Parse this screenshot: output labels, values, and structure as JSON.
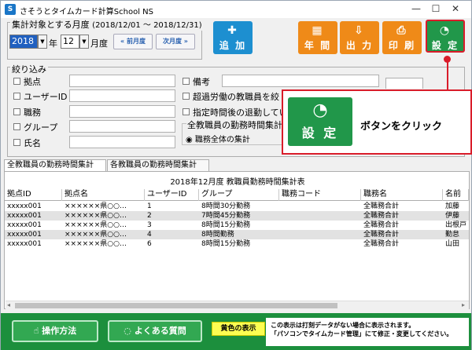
{
  "window": {
    "title": "さそうとタイムカード計算School NS",
    "app_icon": "S",
    "minimize": "—",
    "maximize": "☐",
    "close": "✕"
  },
  "period": {
    "legend": "集計対象とする月度",
    "range": "(2018/12/01 〜 2018/12/31)",
    "year": "2018",
    "year_suffix": "年",
    "month": "12",
    "month_suffix": "月度",
    "prev_label": "« 前月度",
    "next_label": "次月度 »"
  },
  "toolbar": {
    "add": "追 加",
    "annual": "年 間",
    "output": "出 力",
    "print": "印 刷",
    "settings": "設 定",
    "colors": {
      "add": "#1d8fd0",
      "annual": "#ef8a18",
      "output": "#ef8a18",
      "print": "#ef8a18",
      "settings": "#21974a"
    }
  },
  "filter": {
    "legend": "絞り込み",
    "left_items": [
      "拠点",
      "ユーザーID",
      "職務",
      "グループ",
      "氏名"
    ],
    "remarks": "備考",
    "overtime": "超過労働の教職員を絞",
    "late": "指定時間後の退勤してい",
    "aggregation_legend": "全教職員の勤務時間集計",
    "aggregation_option": "職務全体の集計"
  },
  "callout": {
    "button_label": "設 定",
    "text": "ボタンをクリック",
    "color": "#d91c2a"
  },
  "tabs": [
    "全教職員の勤務時間集計",
    "各教職員の勤務時間集計"
  ],
  "table": {
    "title": "2018年12月度 教職員勤務時間集計表",
    "headers": [
      "拠点ID",
      "拠点名",
      "ユーザーID",
      "グループ",
      "職務コード",
      "職務名",
      "名前"
    ],
    "rows": [
      [
        "xxxxx001",
        "××××××県○○…",
        "1",
        "8時間30分勤務",
        "",
        "全職務合計",
        "加藤"
      ],
      [
        "xxxxx001",
        "××××××県○○…",
        "2",
        "7時間45分勤務",
        "",
        "全職務合計",
        "伊藤"
      ],
      [
        "xxxxx001",
        "××××××県○○…",
        "3",
        "8時間15分勤務",
        "",
        "全職務合計",
        "出根戸"
      ],
      [
        "xxxxx001",
        "××××××県○○…",
        "4",
        "8時間勤務",
        "",
        "全職務合計",
        "勤怠"
      ],
      [
        "xxxxx001",
        "××××××県○○…",
        "6",
        "8時間15分勤務",
        "",
        "全職務合計",
        "山田"
      ]
    ]
  },
  "bottom": {
    "manual": "操作方法",
    "faq": "よくある質問",
    "yellow_badge": "黄色の表示",
    "notice_line1": "この表示は打刻データがない場合に表示されます。",
    "notice_line2": "「パソコンでタイムカード管理」にて修正・変更してください。"
  }
}
